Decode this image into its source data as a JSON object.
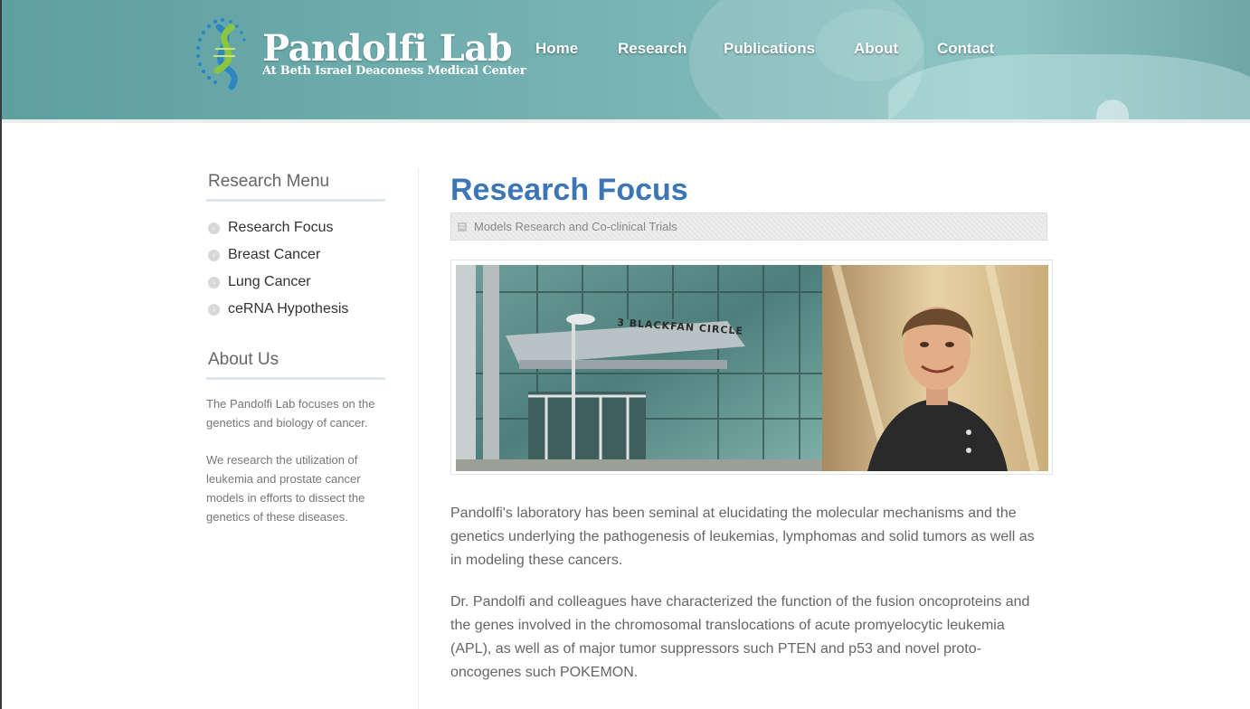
{
  "site": {
    "title": "Pandolfi Lab",
    "subtitle": "At Beth Israel Deaconess Medical Center"
  },
  "nav": [
    {
      "label": "Home"
    },
    {
      "label": "Research"
    },
    {
      "label": "Publications"
    },
    {
      "label": "About"
    },
    {
      "label": "Contact"
    }
  ],
  "sidebar": {
    "research_menu_heading": "Research Menu",
    "menu_items": [
      {
        "label": "Research Focus",
        "icon": "chevron-right-icon"
      },
      {
        "label": "Breast Cancer",
        "icon": "chevron-right-icon"
      },
      {
        "label": "Lung Cancer",
        "icon": "chevron-right-icon"
      },
      {
        "label": "ceRNA Hypothesis",
        "icon": "chevron-right-icon"
      }
    ],
    "about_heading": "About Us",
    "about_paragraphs": [
      "The Pandolfi Lab focuses on the genetics and biology of cancer.",
      "We research the utilization of leukemia and prostate cancer models in efforts to dissect the genetics of these diseases."
    ]
  },
  "main": {
    "title": "Research Focus",
    "breadcrumb": "Models Research and Co-clinical Trials",
    "building_sign": "3 BLACKFAN CIRCLE",
    "paragraphs": [
      "Pandolfi's laboratory has been seminal at elucidating the molecular mechanisms and the genetics underlying the pathogenesis of leukemias, lymphomas and solid tumors as well as in modeling these cancers.",
      "Dr. Pandolfi and colleagues have characterized the function of the fusion oncoproteins and the genes involved in the chromosomal translocations of acute promyelocytic leukemia (APL), as well as of major tumor suppressors such PTEN and p53 and novel proto-oncogenes such POKEMON."
    ]
  },
  "colors": {
    "header_teal": "#6aa9aa",
    "title_blue": "#3d76b6",
    "logo_green": "#8cc63f",
    "logo_blue": "#2e86c1"
  }
}
